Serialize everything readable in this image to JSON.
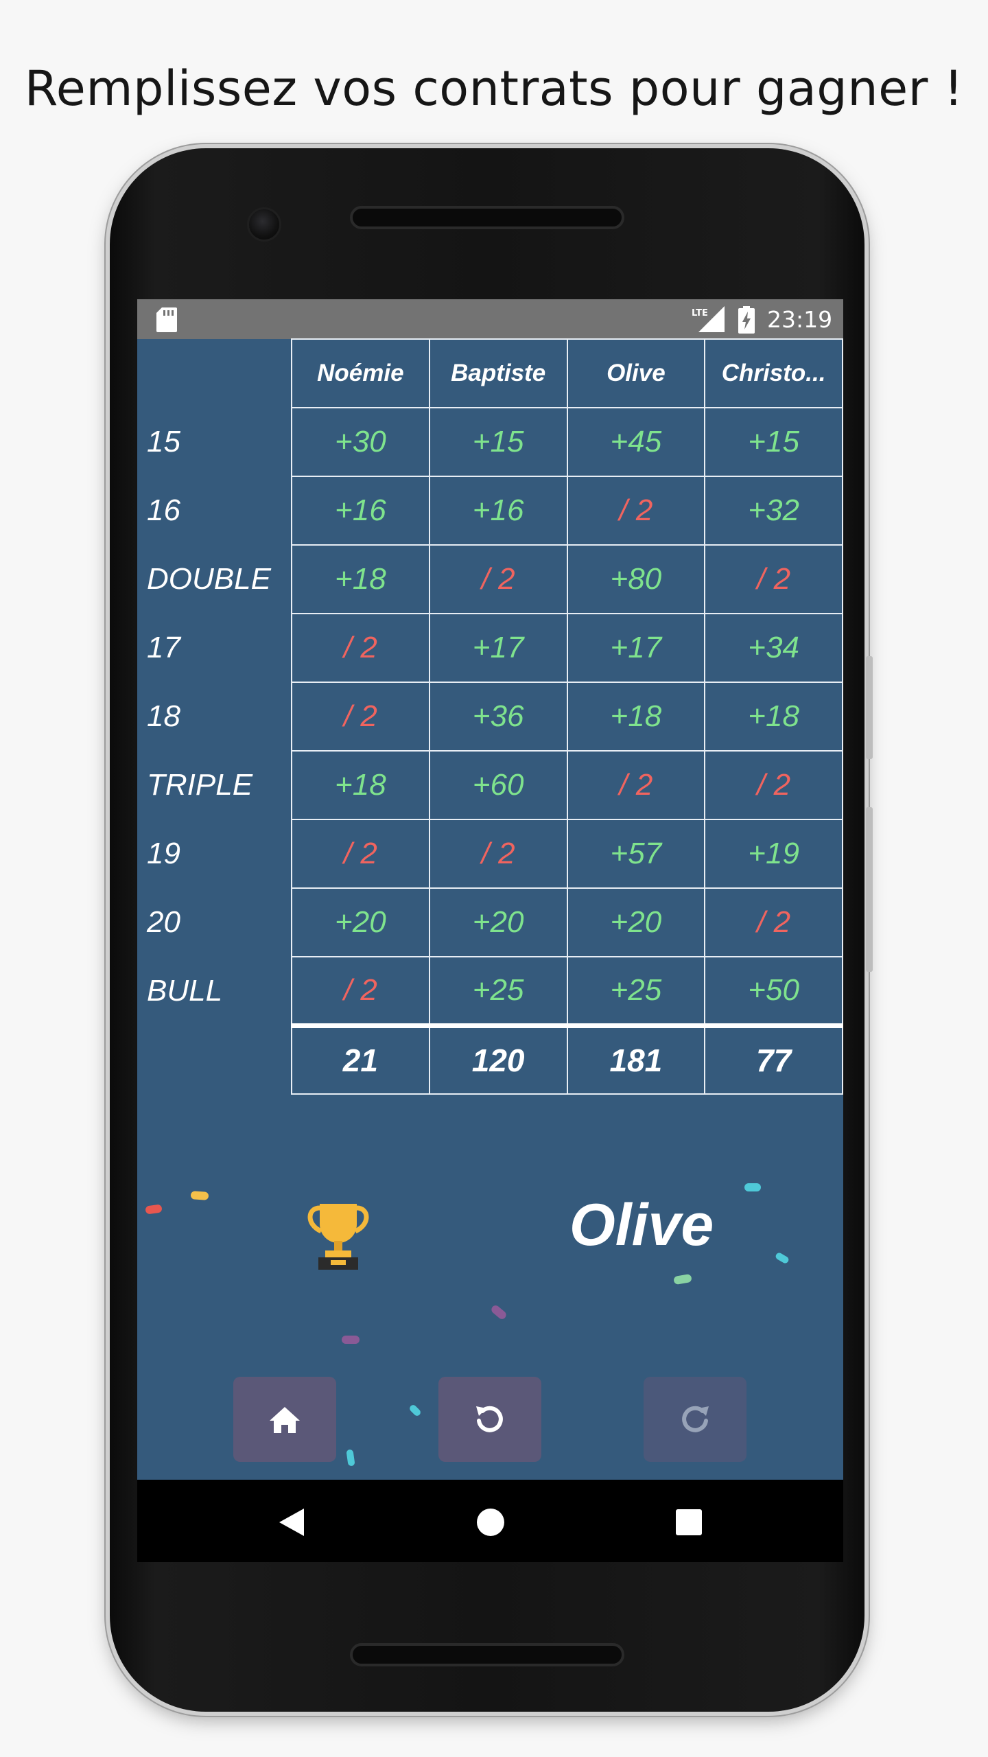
{
  "headline": "Remplissez vos contrats pour gagner !",
  "status_bar": {
    "time": "23:19",
    "network": "LTE"
  },
  "players": [
    "Noémie",
    "Baptiste",
    "Olive",
    "Christo..."
  ],
  "rows": [
    {
      "label": "15",
      "scores": [
        "+30",
        "+15",
        "+45",
        "+15"
      ]
    },
    {
      "label": "16",
      "scores": [
        "+16",
        "+16",
        "/ 2",
        "+32"
      ]
    },
    {
      "label": "DOUBLE",
      "scores": [
        "+18",
        "/ 2",
        "+80",
        "/ 2"
      ]
    },
    {
      "label": "17",
      "scores": [
        "/ 2",
        "+17",
        "+17",
        "+34"
      ]
    },
    {
      "label": "18",
      "scores": [
        "/ 2",
        "+36",
        "+18",
        "+18"
      ]
    },
    {
      "label": "TRIPLE",
      "scores": [
        "+18",
        "+60",
        "/ 2",
        "/ 2"
      ]
    },
    {
      "label": "19",
      "scores": [
        "/ 2",
        "/ 2",
        "+57",
        "+19"
      ]
    },
    {
      "label": "20",
      "scores": [
        "+20",
        "+20",
        "+20",
        "/ 2"
      ]
    },
    {
      "label": "BULL",
      "scores": [
        "/ 2",
        "+25",
        "+25",
        "+50"
      ]
    }
  ],
  "totals": [
    "21",
    "120",
    "181",
    "77"
  ],
  "winner": {
    "name": "Olive",
    "icon": "trophy-icon"
  },
  "actions": [
    {
      "name": "home",
      "icon": "home-icon",
      "enabled": true
    },
    {
      "name": "undo",
      "icon": "undo-icon",
      "enabled": true
    },
    {
      "name": "redo",
      "icon": "redo-icon",
      "enabled": false
    }
  ],
  "colors": {
    "screen_bg": "#355a7c",
    "plus": "#7fe38d",
    "half": "#f0645f",
    "button": "#5b5878"
  }
}
